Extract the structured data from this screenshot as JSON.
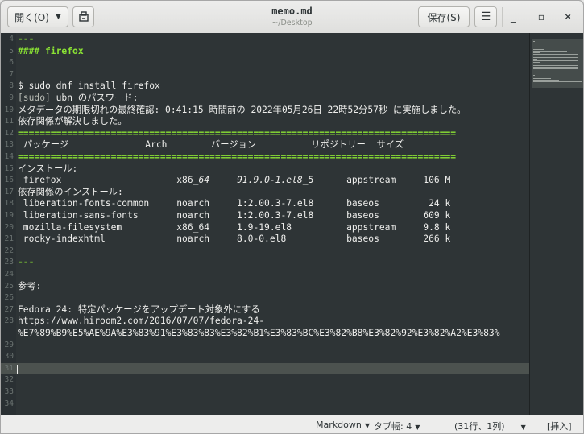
{
  "headerbar": {
    "open_label": "開く(O)",
    "save_label": "保存(S)",
    "title": "memo.md",
    "subtitle": "~/Desktop"
  },
  "editor": {
    "lines": [
      {
        "n": "4",
        "text": "---",
        "style": "green"
      },
      {
        "n": "5",
        "text": "#### firefox",
        "style": "green"
      },
      {
        "n": "6",
        "text": "",
        "style": ""
      },
      {
        "n": "7",
        "text": "",
        "style": ""
      },
      {
        "n": "8",
        "text": "$ sudo dnf install firefox",
        "style": ""
      },
      {
        "n": "9",
        "text": "[sudo] ubn のパスワード:",
        "style": ""
      },
      {
        "n": "10",
        "text": "メタデータの期限切れの最終確認: 0:41:15 時間前の 2022年05月26日 22時52分57秒 に実施しました。",
        "style": ""
      },
      {
        "n": "11",
        "text": "依存関係が解決しました。",
        "style": ""
      },
      {
        "n": "12",
        "text": "================================================================================",
        "style": "green"
      },
      {
        "n": "13",
        "text": " パッケージ              Arch        バージョン          リポジトリー  サイズ",
        "style": ""
      },
      {
        "n": "14",
        "text": "================================================================================",
        "style": "green"
      },
      {
        "n": "15",
        "text": "インストール:",
        "style": ""
      },
      {
        "n": "16",
        "text": " firefox                     x86_64     91.9.0-1.el8_5      appstream     106 M",
        "style": ""
      },
      {
        "n": "17",
        "text": "依存関係のインストール:",
        "style": ""
      },
      {
        "n": "18",
        "text": " liberation-fonts-common     noarch     1:2.00.3-7.el8      baseos         24 k",
        "style": ""
      },
      {
        "n": "19",
        "text": " liberation-sans-fonts       noarch     1:2.00.3-7.el8      baseos        609 k",
        "style": ""
      },
      {
        "n": "20",
        "text": " mozilla-filesystem          x86_64     1.9-19.el8          appstream     9.8 k",
        "style": ""
      },
      {
        "n": "21",
        "text": " rocky-indexhtml             noarch     8.0-0.el8           baseos        266 k",
        "style": ""
      },
      {
        "n": "22",
        "text": "",
        "style": ""
      },
      {
        "n": "23",
        "text": "---",
        "style": "green"
      },
      {
        "n": "24",
        "text": "",
        "style": ""
      },
      {
        "n": "25",
        "text": "参考:",
        "style": ""
      },
      {
        "n": "26",
        "text": "",
        "style": ""
      },
      {
        "n": "27",
        "text": "Fedora 24: 特定パッケージをアップデート対象外にする",
        "style": ""
      },
      {
        "n": "28",
        "text": "https://www.hiroom2.com/2016/07/07/fedora-24-",
        "style": ""
      },
      {
        "n": "",
        "text": "%E7%89%B9%E5%AE%9A%E3%83%91%E3%83%83%E3%82%B1%E3%83%BC%E3%82%B8%E3%82%92%E3%82%A2%E3%83%",
        "style": ""
      },
      {
        "n": "29",
        "text": "",
        "style": ""
      },
      {
        "n": "30",
        "text": "",
        "style": ""
      },
      {
        "n": "31",
        "text": "",
        "style": "current"
      },
      {
        "n": "32",
        "text": "",
        "style": ""
      },
      {
        "n": "33",
        "text": "",
        "style": ""
      },
      {
        "n": "34",
        "text": "",
        "style": ""
      }
    ]
  },
  "statusbar": {
    "language": "Markdown",
    "tab_width": "タブ幅: 4",
    "position": "(31行、1列)",
    "mode": "[挿入]"
  }
}
